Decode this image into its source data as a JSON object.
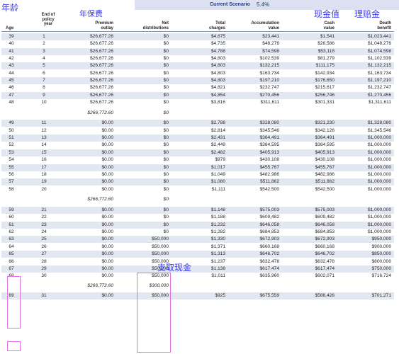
{
  "annotations": {
    "age": "年龄",
    "annual_premium": "年保费",
    "cash_value": "现金值",
    "death_benefit": "理赔金",
    "withdrawal": "支取现金"
  },
  "scenario": {
    "label": "Current Scenario",
    "value": "5.4%"
  },
  "headers": {
    "age": "Age",
    "policy_year": [
      "End of",
      "policy",
      "year"
    ],
    "premium": [
      "Premium",
      "outlay"
    ],
    "distributions": [
      "Net",
      "distributions"
    ],
    "charges": [
      "Total",
      "charges"
    ],
    "accumulation": [
      "Accumulation",
      "value"
    ],
    "cash": [
      "Cash",
      "value"
    ],
    "death": [
      "Death",
      "benefit"
    ]
  },
  "table": [
    {
      "age": "39",
      "year": "1",
      "premium": "$26,677.26",
      "dist": "$0",
      "charges": "$4,675",
      "accum": "$23,441",
      "cash": "$1,541",
      "death": "$1,023,441"
    },
    {
      "age": "40",
      "year": "2",
      "premium": "$26,677.26",
      "dist": "$0",
      "charges": "$4,735",
      "accum": "$48,276",
      "cash": "$26,586",
      "death": "$1,048,276"
    },
    {
      "age": "41",
      "year": "3",
      "premium": "$26,677.26",
      "dist": "$0",
      "charges": "$4,788",
      "accum": "$74,598",
      "cash": "$53,118",
      "death": "$1,074,598"
    },
    {
      "age": "42",
      "year": "4",
      "premium": "$26,677.26",
      "dist": "$0",
      "charges": "$4,803",
      "accum": "$102,539",
      "cash": "$81,279",
      "death": "$1,102,539"
    },
    {
      "age": "43",
      "year": "5",
      "premium": "$26,677.26",
      "dist": "$0",
      "charges": "$4,803",
      "accum": "$132,215",
      "cash": "$111,175",
      "death": "$1,132,215"
    },
    {
      "age": "44",
      "year": "6",
      "premium": "$26,677.26",
      "dist": "$0",
      "charges": "$4,803",
      "accum": "$163,734",
      "cash": "$142,934",
      "death": "$1,163,734"
    },
    {
      "age": "45",
      "year": "7",
      "premium": "$26,677.26",
      "dist": "$0",
      "charges": "$4,803",
      "accum": "$197,210",
      "cash": "$176,650",
      "death": "$1,197,210"
    },
    {
      "age": "46",
      "year": "8",
      "premium": "$26,677.26",
      "dist": "$0",
      "charges": "$4,821",
      "accum": "$232,747",
      "cash": "$215,617",
      "death": "$1,232,747"
    },
    {
      "age": "47",
      "year": "9",
      "premium": "$26,677.26",
      "dist": "$0",
      "charges": "$4,854",
      "accum": "$270,456",
      "cash": "$256,746",
      "death": "$1,270,456"
    },
    {
      "age": "48",
      "year": "10",
      "premium": "$26,677.26",
      "dist": "$0",
      "charges": "$3,816",
      "accum": "$311,611",
      "cash": "$301,331",
      "death": "$1,311,611"
    },
    {
      "subtotal": true,
      "premium": "$266,772.60",
      "dist": "$0"
    },
    {
      "age": "49",
      "year": "11",
      "premium": "$0.00",
      "dist": "$0",
      "charges": "$2,788",
      "accum": "$328,080",
      "cash": "$321,230",
      "death": "$1,328,080"
    },
    {
      "age": "50",
      "year": "12",
      "premium": "$0.00",
      "dist": "$0",
      "charges": "$2,814",
      "accum": "$345,546",
      "cash": "$342,126",
      "death": "$1,345,546"
    },
    {
      "age": "51",
      "year": "13",
      "premium": "$0.00",
      "dist": "$0",
      "charges": "$2,431",
      "accum": "$364,491",
      "cash": "$364,491",
      "death": "$1,000,000"
    },
    {
      "age": "52",
      "year": "14",
      "premium": "$0.00",
      "dist": "$0",
      "charges": "$2,449",
      "accum": "$384,595",
      "cash": "$384,595",
      "death": "$1,000,000"
    },
    {
      "age": "53",
      "year": "15",
      "premium": "$0.00",
      "dist": "$0",
      "charges": "$2,482",
      "accum": "$405,913",
      "cash": "$405,913",
      "death": "$1,000,000"
    },
    {
      "age": "54",
      "year": "16",
      "premium": "$0.00",
      "dist": "$0",
      "charges": "$979",
      "accum": "$430,108",
      "cash": "$430,108",
      "death": "$1,000,000"
    },
    {
      "age": "55",
      "year": "17",
      "premium": "$0.00",
      "dist": "$0",
      "charges": "$1,017",
      "accum": "$455,767",
      "cash": "$455,767",
      "death": "$1,000,000"
    },
    {
      "age": "56",
      "year": "18",
      "premium": "$0.00",
      "dist": "$0",
      "charges": "$1,049",
      "accum": "$482,986",
      "cash": "$482,986",
      "death": "$1,000,000"
    },
    {
      "age": "57",
      "year": "19",
      "premium": "$0.00",
      "dist": "$0",
      "charges": "$1,080",
      "accum": "$511,862",
      "cash": "$511,862",
      "death": "$1,000,000"
    },
    {
      "age": "58",
      "year": "20",
      "premium": "$0.00",
      "dist": "$0",
      "charges": "$1,111",
      "accum": "$542,500",
      "cash": "$542,500",
      "death": "$1,000,000"
    },
    {
      "subtotal": true,
      "premium": "$266,772.60",
      "dist": "$0"
    },
    {
      "age": "59",
      "year": "21",
      "premium": "$0.00",
      "dist": "$0",
      "charges": "$1,148",
      "accum": "$575,003",
      "cash": "$575,003",
      "death": "$1,000,000"
    },
    {
      "age": "60",
      "year": "22",
      "premium": "$0.00",
      "dist": "$0",
      "charges": "$1,188",
      "accum": "$609,482",
      "cash": "$609,482",
      "death": "$1,000,000"
    },
    {
      "age": "61",
      "year": "23",
      "premium": "$0.00",
      "dist": "$0",
      "charges": "$1,232",
      "accum": "$646,058",
      "cash": "$646,058",
      "death": "$1,000,000"
    },
    {
      "age": "62",
      "year": "24",
      "premium": "$0.00",
      "dist": "$0",
      "charges": "$1,282",
      "accum": "$684,853",
      "cash": "$684,853",
      "death": "$1,000,000"
    },
    {
      "age": "63",
      "year": "25",
      "premium": "$0.00",
      "dist": "$50,000",
      "charges": "$1,330",
      "accum": "$672,903",
      "cash": "$672,903",
      "death": "$950,000"
    },
    {
      "age": "64",
      "year": "26",
      "premium": "$0.00",
      "dist": "$50,000",
      "charges": "$1,371",
      "accum": "$660,168",
      "cash": "$660,168",
      "death": "$900,000"
    },
    {
      "age": "65",
      "year": "27",
      "premium": "$0.00",
      "dist": "$50,000",
      "charges": "$1,313",
      "accum": "$646,702",
      "cash": "$646,702",
      "death": "$850,000"
    },
    {
      "age": "66",
      "year": "28",
      "premium": "$0.00",
      "dist": "$50,000",
      "charges": "$1,237",
      "accum": "$632,478",
      "cash": "$632,478",
      "death": "$800,000"
    },
    {
      "age": "67",
      "year": "29",
      "premium": "$0.00",
      "dist": "$50,000",
      "charges": "$1,138",
      "accum": "$617,474",
      "cash": "$617,474",
      "death": "$750,000"
    },
    {
      "age": "68",
      "year": "30",
      "premium": "$0.00",
      "dist": "$50,000",
      "charges": "$1,011",
      "accum": "$635,960",
      "cash": "$602,071",
      "death": "$716,724"
    },
    {
      "subtotal": true,
      "premium": "$266,772.60",
      "dist": "$300,000"
    },
    {
      "age": "69",
      "year": "31",
      "premium": "$0.00",
      "dist": "$50,000",
      "charges": "$925",
      "accum": "$675,559",
      "cash": "$586,426",
      "death": "$701,271"
    }
  ]
}
